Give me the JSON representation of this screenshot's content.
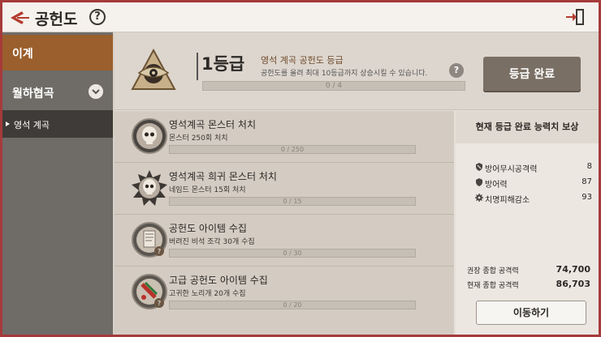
{
  "header": {
    "title": "공헌도",
    "help": "?"
  },
  "sidebar": {
    "items": [
      {
        "label": "이계"
      },
      {
        "label": "월하협곡"
      },
      {
        "label": "영석 계곡"
      }
    ]
  },
  "grade": {
    "title": "1등급",
    "name": "영석 계곡 공헌도 등급",
    "desc": "공헌도를 올려 최대 10등급까지 상승시킬 수 있습니다.",
    "progress": "0 / 4",
    "progress_value": 0,
    "progress_max": 4,
    "help": "?",
    "complete_button": "등급 완료"
  },
  "missions": [
    {
      "title": "영석계곡 몬스터 처치",
      "sub": "몬스터 250회 처치",
      "progress": "0 / 250",
      "value": 0,
      "max": 250
    },
    {
      "title": "영석계곡 희귀 몬스터 처치",
      "sub": "네임드 몬스터 15회 처치",
      "progress": "0 / 15",
      "value": 0,
      "max": 15
    },
    {
      "title": "공헌도 아이템 수집",
      "sub": "버려진 비석 조각 30개 수집",
      "progress": "0 / 30",
      "value": 0,
      "max": 30
    },
    {
      "title": "고급 공헌도 아이템 수집",
      "sub": "고귀한 노리개 20개 수집",
      "progress": "0 / 20",
      "value": 0,
      "max": 20
    }
  ],
  "reward": {
    "heading": "현재 등급 완료 능력치 보상",
    "stats": [
      {
        "label": "방어무시공격력",
        "value": "8",
        "icon": "shield-pierce-icon"
      },
      {
        "label": "방어력",
        "value": "87",
        "icon": "shield-icon"
      },
      {
        "label": "치명피해감소",
        "value": "93",
        "icon": "gear-icon"
      }
    ],
    "recommended_label": "권장 종합 공격력",
    "recommended_value": "74,700",
    "current_label": "현재 종합 공격력",
    "current_value": "86,703",
    "move_button": "이동하기"
  },
  "colors": {
    "frame": "#a63a3a",
    "accent": "#9a5f2c",
    "button_dark": "#7a6f64"
  }
}
